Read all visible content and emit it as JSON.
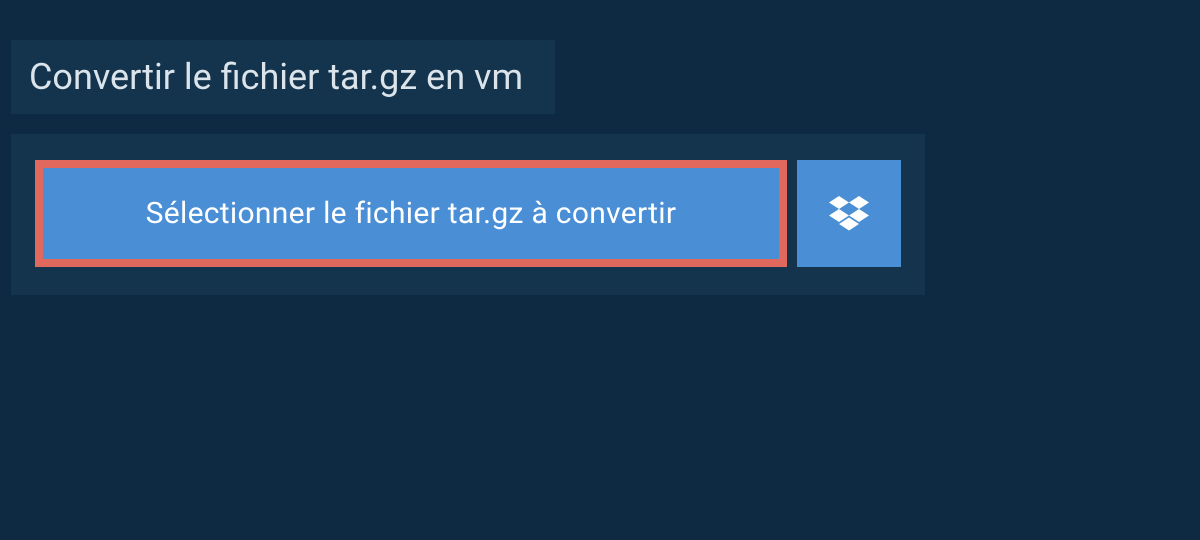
{
  "title": "Convertir le fichier tar.gz en vm",
  "selectButton": {
    "label": "Sélectionner le fichier tar.gz à convertir"
  },
  "colors": {
    "pageBg": "#0e2a42",
    "panelBg": "#14344e",
    "buttonBg": "#4a8fd6",
    "highlightBorder": "#e0685d",
    "text": "#dbe4ea"
  }
}
